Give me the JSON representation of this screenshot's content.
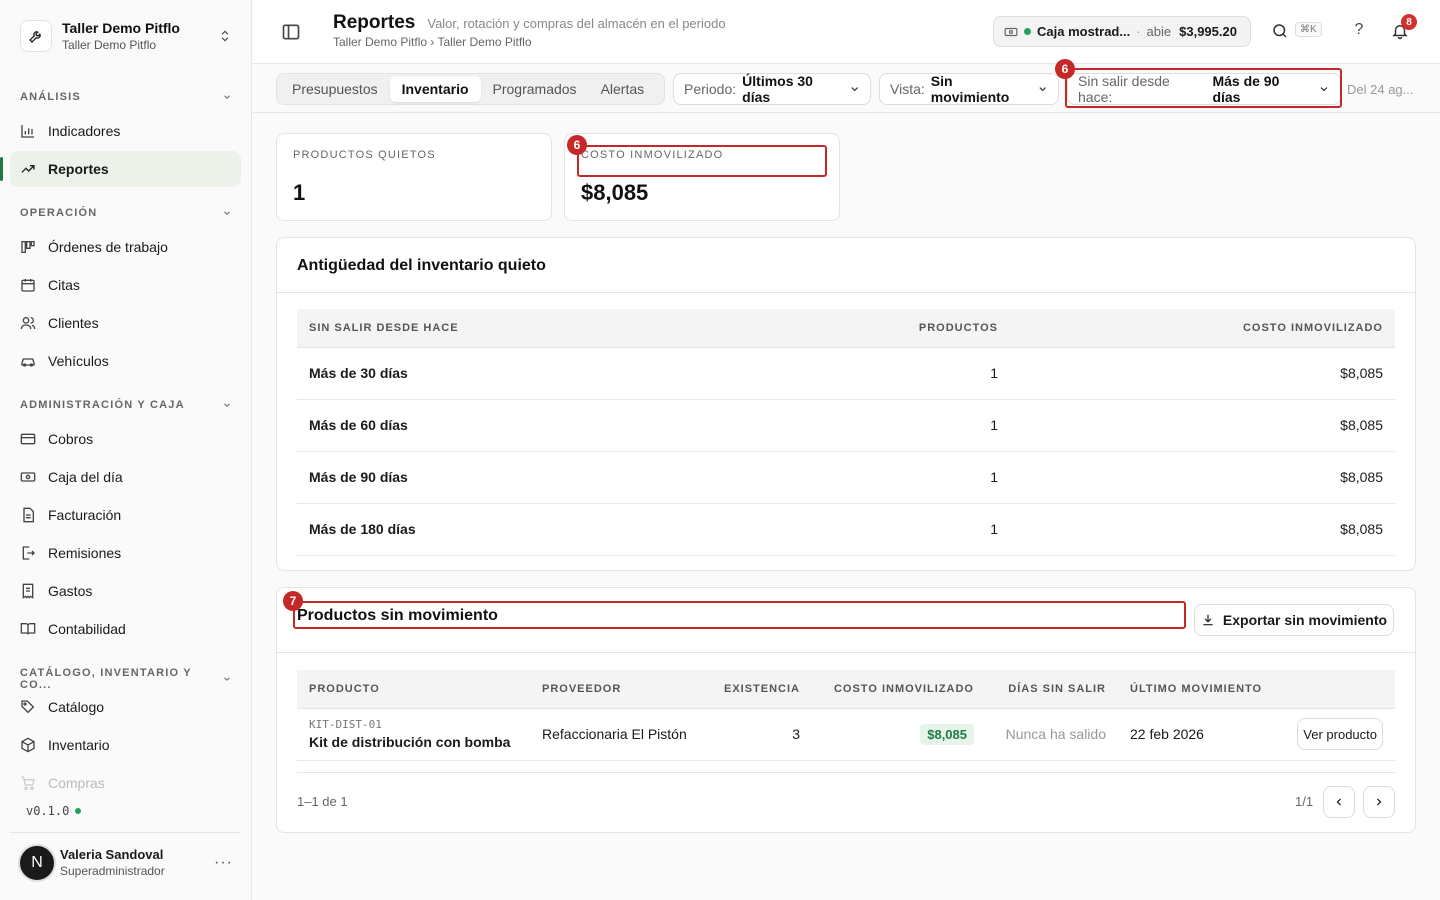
{
  "org": {
    "name": "Taller Demo Pitflo",
    "sub": "Taller Demo Pitflo"
  },
  "sidebar": {
    "sections": [
      {
        "label": "ANÁLISIS"
      },
      {
        "label": "OPERACIÓN"
      },
      {
        "label": "ADMINISTRACIÓN Y CAJA"
      },
      {
        "label": "CATÁLOGO, INVENTARIO Y CO..."
      }
    ],
    "items": [
      {
        "label": "Indicadores",
        "icon": "bar-chart-icon"
      },
      {
        "label": "Reportes",
        "icon": "trend-up-icon"
      },
      {
        "label": "Órdenes de trabajo",
        "icon": "kanban-icon"
      },
      {
        "label": "Citas",
        "icon": "calendar-icon"
      },
      {
        "label": "Clientes",
        "icon": "users-icon"
      },
      {
        "label": "Vehículos",
        "icon": "car-icon"
      },
      {
        "label": "Cobros",
        "icon": "credit-card-icon"
      },
      {
        "label": "Caja del día",
        "icon": "cash-icon"
      },
      {
        "label": "Facturación",
        "icon": "document-icon"
      },
      {
        "label": "Remisiones",
        "icon": "file-export-icon"
      },
      {
        "label": "Gastos",
        "icon": "receipt-icon"
      },
      {
        "label": "Contabilidad",
        "icon": "book-icon"
      },
      {
        "label": "Catálogo",
        "icon": "tag-icon"
      },
      {
        "label": "Inventario",
        "icon": "box-icon"
      },
      {
        "label": "Compras",
        "icon": "cart-icon"
      }
    ],
    "version": "v0.1.0"
  },
  "user": {
    "initial": "N",
    "name": "Valeria Sandoval",
    "role": "Superadministrador",
    "more": "···"
  },
  "header": {
    "title": "Reportes",
    "subtitle": "Valor, rotación y compras del almacén en el periodo",
    "breadcrumb": "Taller Demo Pitflo › Taller Demo Pitflo",
    "cash": {
      "name": "Caja mostrad...",
      "sep": "·",
      "status": "abie",
      "amount": "$3,995.20"
    },
    "shortcut": "⌘K",
    "help": "?",
    "notifications": "8"
  },
  "toolbar": {
    "tabs": [
      "Presupuestos",
      "Inventario",
      "Programados",
      "Alertas"
    ],
    "periodo": {
      "label": "Periodo:",
      "value": "Últimos 30 días"
    },
    "vista": {
      "label": "Vista:",
      "value": "Sin movimiento"
    },
    "sinsalir": {
      "label": "Sin salir desde hace:",
      "value": "Más de 90 días"
    },
    "date_range": "Del 24 ag..."
  },
  "annotations": {
    "a6": "6",
    "a6b": "6",
    "a7": "7"
  },
  "kpis": {
    "quietos": {
      "label": "PRODUCTOS QUIETOS",
      "value": "1"
    },
    "costo": {
      "label": "COSTO INMOVILIZADO",
      "value": "$8,085"
    }
  },
  "aging": {
    "title": "Antigüedad del inventario quieto",
    "headers": [
      "SIN SALIR DESDE HACE",
      "PRODUCTOS",
      "COSTO INMOVILIZADO"
    ],
    "rows": [
      {
        "range": "Más de 30 días",
        "products": "1",
        "cost": "$8,085"
      },
      {
        "range": "Más de 60 días",
        "products": "1",
        "cost": "$8,085"
      },
      {
        "range": "Más de 90 días",
        "products": "1",
        "cost": "$8,085"
      },
      {
        "range": "Más de 180 días",
        "products": "1",
        "cost": "$8,085"
      }
    ]
  },
  "stale": {
    "title": "Productos sin movimiento",
    "export_label": "Exportar sin movimiento",
    "headers": [
      "PRODUCTO",
      "PROVEEDOR",
      "EXISTENCIA",
      "COSTO INMOVILIZADO",
      "DÍAS SIN SALIR",
      "ÚLTIMO MOVIMIENTO"
    ],
    "rows": [
      {
        "sku": "KIT-DIST-01",
        "name": "Kit de distribución con bomba",
        "supplier": "Refaccionaria El Pistón",
        "stock": "3",
        "cost": "$8,085",
        "days": "Nunca ha salido",
        "last": "22 feb 2026",
        "action": "Ver producto"
      }
    ],
    "pager_info": "1–1 de 1",
    "pager_pages": "1/1"
  }
}
